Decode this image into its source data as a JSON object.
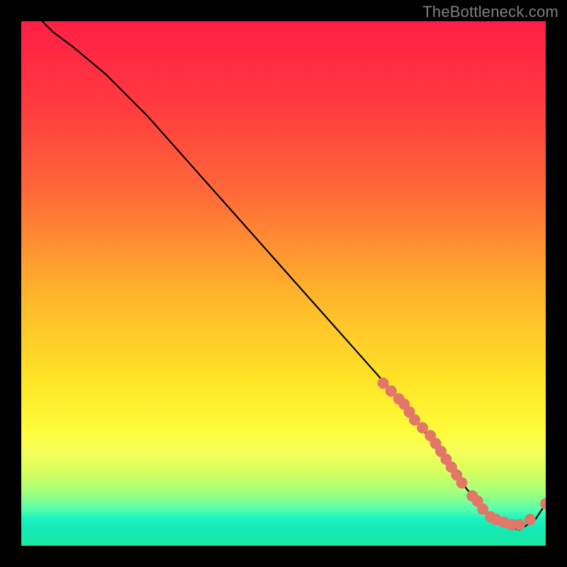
{
  "watermark": "TheBottleneck.com",
  "chart_data": {
    "type": "line",
    "title": "",
    "xlabel": "",
    "ylabel": "",
    "xlim": [
      0,
      100
    ],
    "ylim": [
      0,
      100
    ],
    "grid": false,
    "legend": false,
    "series": [
      {
        "name": "curve",
        "color": "#000000",
        "x": [
          4,
          6,
          10,
          16,
          24,
          32,
          40,
          48,
          56,
          64,
          72,
          79,
          84,
          88,
          92,
          95,
          98,
          100
        ],
        "y": [
          100,
          98,
          95,
          90,
          82,
          73,
          64,
          55,
          46,
          37,
          28,
          19,
          12,
          7,
          4,
          3,
          5,
          8
        ]
      }
    ],
    "markers": {
      "name": "highlight-dots",
      "color": "#e27668",
      "radius": 8,
      "x": [
        69,
        70.5,
        72,
        73,
        74,
        75,
        76.5,
        78,
        79,
        80,
        81,
        82,
        83,
        84,
        86,
        87,
        88,
        89.5,
        90.5,
        92,
        93.5,
        95,
        97,
        100
      ],
      "y": [
        31,
        29.5,
        28,
        27,
        25.5,
        24,
        22.5,
        21,
        19.5,
        18,
        16.5,
        15,
        13.5,
        12,
        9.5,
        8.5,
        7,
        5.5,
        5,
        4.5,
        4,
        4,
        5,
        8
      ]
    },
    "background_gradient": {
      "direction": "vertical",
      "stops": [
        {
          "pos": 0.0,
          "color": "#ff1f45"
        },
        {
          "pos": 0.34,
          "color": "#ff6e37"
        },
        {
          "pos": 0.68,
          "color": "#ffe326"
        },
        {
          "pos": 0.86,
          "color": "#d6ff5e"
        },
        {
          "pos": 0.95,
          "color": "#19f2bf"
        },
        {
          "pos": 1.0,
          "color": "#19e8a2"
        }
      ]
    }
  }
}
